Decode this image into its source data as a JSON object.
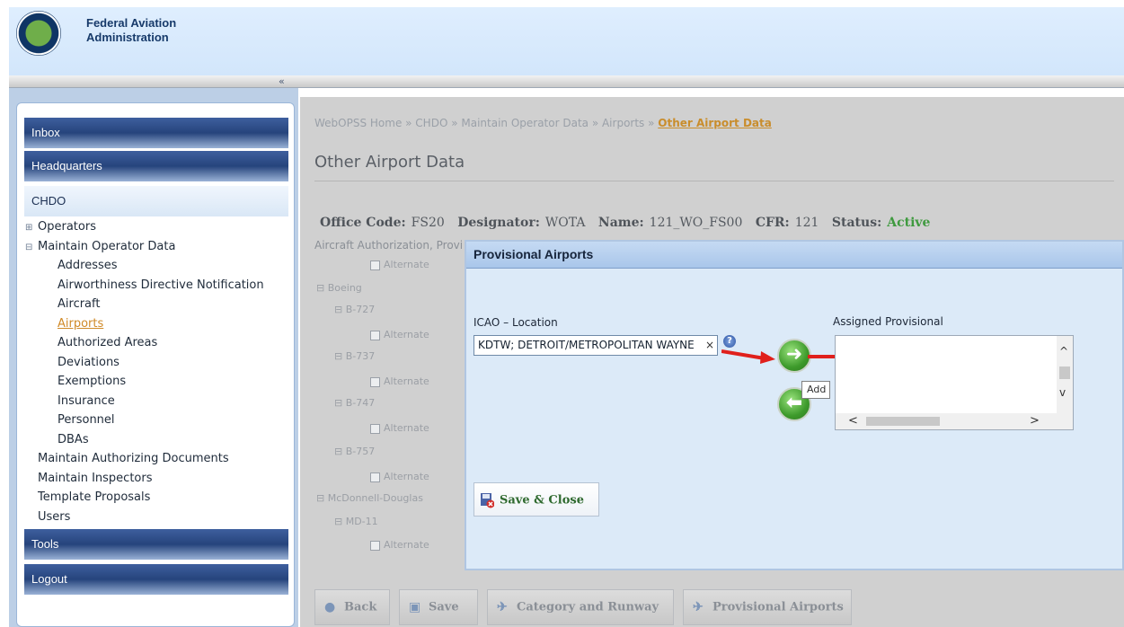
{
  "header": {
    "brand_line1": "Federal Aviation",
    "brand_line2": "Administration",
    "collapse_glyph": "«"
  },
  "sidebar": {
    "inbox": "Inbox",
    "headquarters": "Headquarters",
    "chdo": "CHDO",
    "tree": [
      {
        "label": "Operators",
        "toggle": "⊞",
        "level": "l0"
      },
      {
        "label": "Maintain Operator Data",
        "toggle": "⊟",
        "level": "l0"
      },
      {
        "label": "Addresses",
        "level": "sub"
      },
      {
        "label": "Airworthiness Directive Notification",
        "level": "sub"
      },
      {
        "label": "Aircraft",
        "level": "sub"
      },
      {
        "label": "Airports",
        "level": "sub",
        "active": true
      },
      {
        "label": "Authorized Areas",
        "level": "sub"
      },
      {
        "label": "Deviations",
        "level": "sub"
      },
      {
        "label": "Exemptions",
        "level": "sub"
      },
      {
        "label": "Insurance",
        "level": "sub"
      },
      {
        "label": "Personnel",
        "level": "sub"
      },
      {
        "label": "DBAs",
        "level": "sub"
      },
      {
        "label": "Maintain Authorizing Documents",
        "level": "l1"
      },
      {
        "label": "Maintain Inspectors",
        "level": "l1"
      },
      {
        "label": "Template Proposals",
        "level": "l1"
      },
      {
        "label": "Users",
        "level": "l1"
      }
    ],
    "tools": "Tools",
    "logout": "Logout"
  },
  "main": {
    "breadcrumb": {
      "path": "WebOPSS Home » CHDO » Maintain Operator Data » Airports » ",
      "current": "Other Airport Data"
    },
    "title": "Other Airport Data",
    "info": {
      "office_code_label": "Office Code:",
      "office_code": "FS20",
      "designator_label": "Designator:",
      "designator": "WOTA",
      "name_label": "Name:",
      "name": "121_WO_FS00",
      "cfr_label": "CFR:",
      "cfr": "121",
      "status_label": "Status:",
      "status": "Active"
    },
    "aircraft_auth_label": "Aircraft Authorization, Provi",
    "bg_tree": {
      "alternate": "Alternate",
      "boeing": "Boeing",
      "b727": "B-727",
      "b737": "B-737",
      "b747": "B-747",
      "b757": "B-757",
      "mcdonnell": "McDonnell-Douglas",
      "md11": "MD-11"
    },
    "buttons": {
      "back": "Back",
      "save": "Save",
      "category_runway": "Category and Runway",
      "provisional_airports": "Provisional Airports"
    }
  },
  "modal": {
    "title": "Provisional Airports",
    "icao_label": "ICAO – Location",
    "icao_value": "KDTW; DETROIT/METROPOLITAN WAYNE",
    "clear_glyph": "×",
    "help_glyph": "?",
    "add_tooltip": "Add",
    "assigned_label": "Assigned Provisional",
    "save_close": "Save & Close",
    "colors": {
      "arrow": "#e0201c",
      "green_button": "#3d9a2b"
    }
  }
}
